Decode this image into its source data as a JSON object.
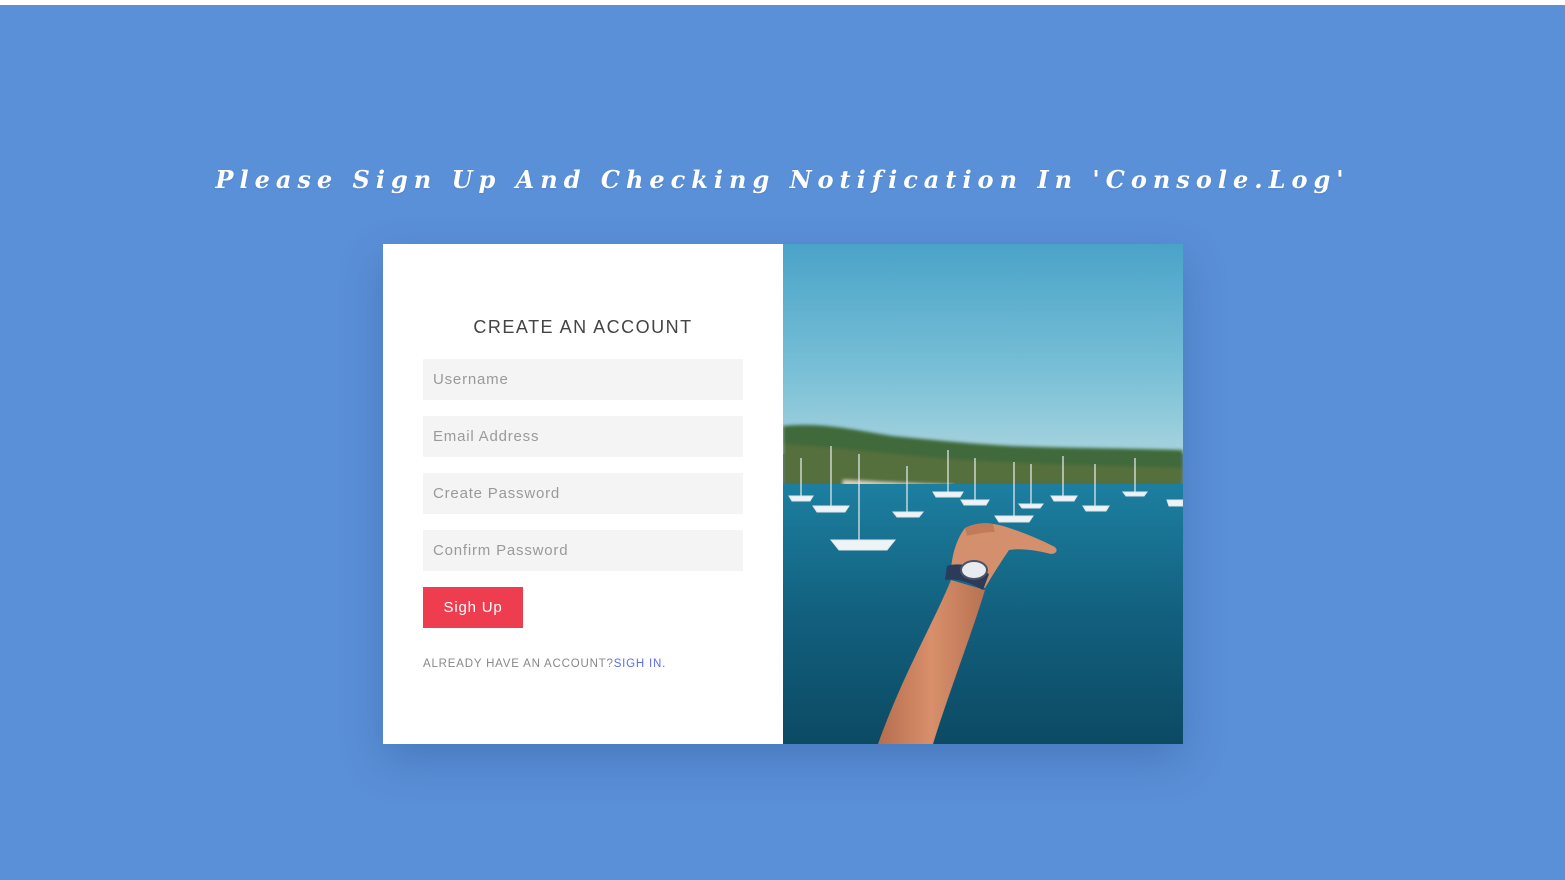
{
  "page": {
    "heading": "Please Sign Up And Checking Notification In 'Console.Log'"
  },
  "form": {
    "title": "CREATE AN ACCOUNT",
    "fields": [
      {
        "name": "username",
        "placeholder": "Username",
        "value": ""
      },
      {
        "name": "email",
        "placeholder": "Email Address",
        "value": ""
      },
      {
        "name": "password",
        "placeholder": "Create Password",
        "value": ""
      },
      {
        "name": "confirm",
        "placeholder": "Confirm Password",
        "value": ""
      }
    ],
    "submit_label": "Sigh Up",
    "signin_prompt": "ALREADY HAVE AN ACCOUNT?",
    "signin_link": "SIGH IN."
  },
  "photo": {
    "subject": "hand-reaching-over-bay-with-sailboats"
  },
  "colors": {
    "background": "#5a90d8",
    "button": "#ee3d4e",
    "link": "#5b6cf0",
    "field_bg": "#f4f4f4"
  }
}
